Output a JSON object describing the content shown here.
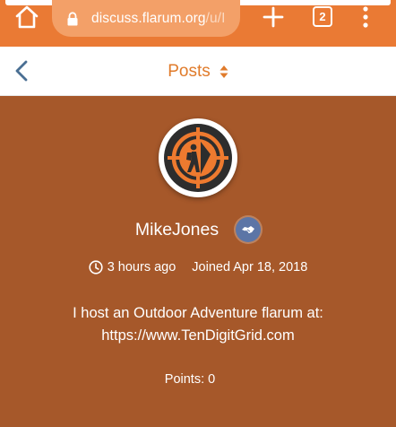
{
  "browser": {
    "url_domain": "discuss.flarum.org",
    "url_path": "/u/I",
    "tab_count": "2",
    "icons": [
      "home-icon",
      "lock-icon",
      "plus-icon",
      "tabs-icon",
      "more-vert-icon"
    ],
    "bar_color": "#ea7a34"
  },
  "header": {
    "title": "Posts",
    "back_icon": "chevron-left-icon",
    "sort_icon": "sort-icon",
    "accent": "#e07b2b"
  },
  "profile": {
    "username": "MikeJones",
    "last_seen": "3 hours ago",
    "joined": "Joined Apr 18, 2018",
    "bio_line1": "I host an Outdoor Adventure flarum at:",
    "bio_line2": "https://www.TenDigitGrid.com",
    "points": "Points: 0",
    "hero_color": "#a6582a",
    "badge_color": "#5c75a6",
    "badge_icon": "handshake-icon",
    "avatar_icon": "hiker-compass-logo"
  }
}
